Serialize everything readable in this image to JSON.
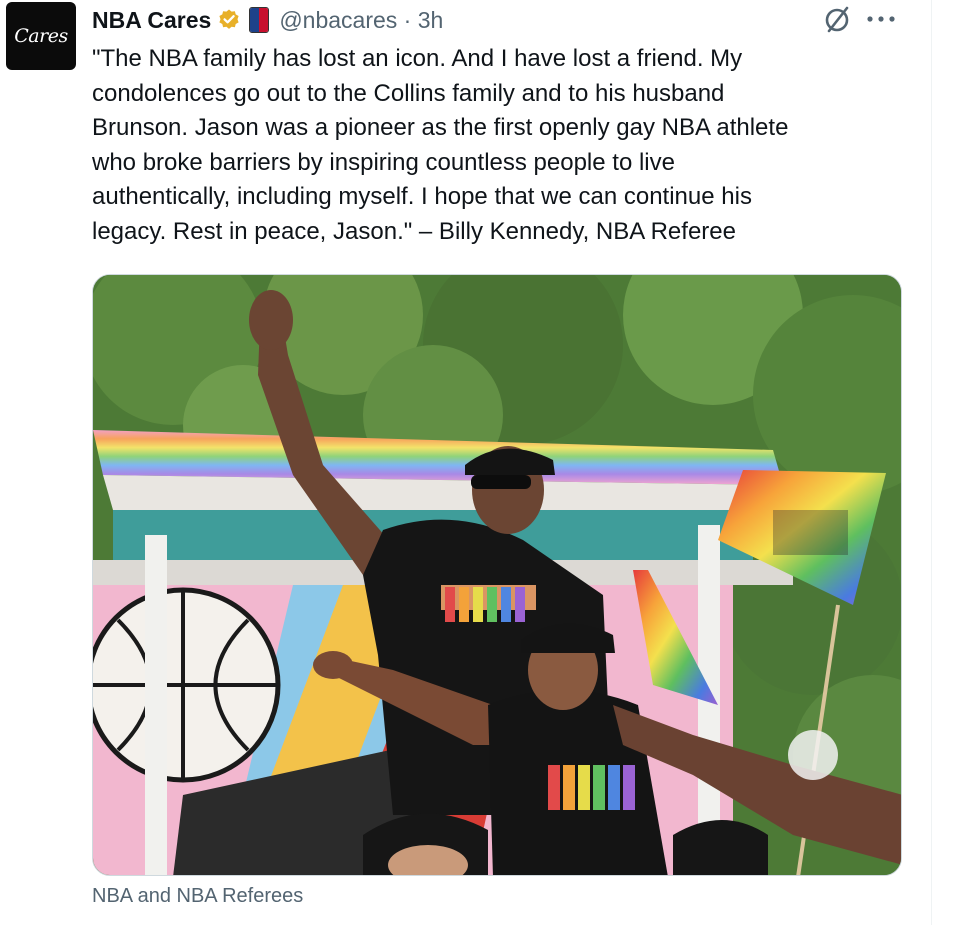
{
  "author": {
    "name": "NBA Cares",
    "handle": "@nbacares",
    "time": "3h",
    "avatar_text": "Cares",
    "verified_badge_color": "#e8b029"
  },
  "tweet": {
    "lines": [
      "\"The NBA family has lost an icon. And I have lost a friend. My",
      "condolences go out to the Collins family and to his husband",
      "Brunson. Jason was a pioneer as the first openly gay NBA athlete",
      "who broke barriers by inspiring countless people to live",
      "authentically, including myself. I hope that we can continue his",
      "legacy. Rest in peace, Jason.\" – Billy Kennedy, NBA Referee"
    ]
  },
  "media": {
    "caption": "NBA and NBA Referees"
  },
  "icons": {
    "grok": "grok-icon",
    "more": "more-icon",
    "verified": "verified-badge-icon"
  }
}
